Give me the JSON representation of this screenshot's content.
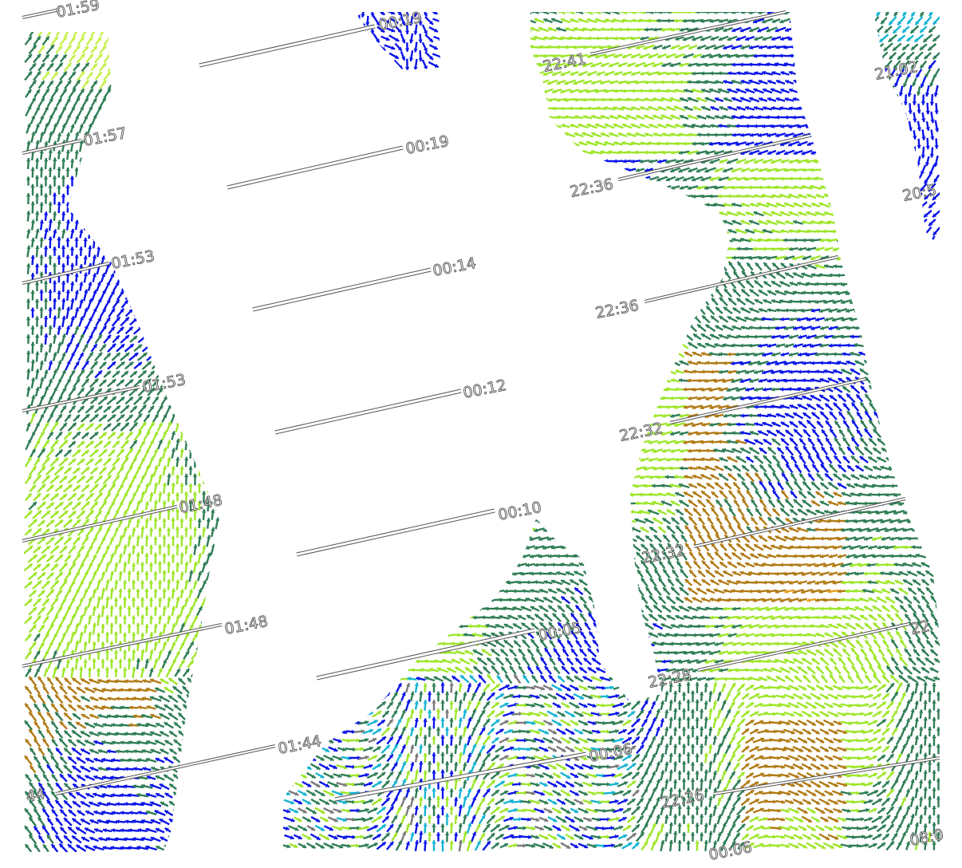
{
  "map": {
    "kind": "scatterometer wind vector swaths",
    "colors": {
      "background": "#ffffff",
      "blue": "#0a14e6",
      "cyan": "#17b4d2",
      "grey": "#7a7a7a",
      "dark_green": "#2e7d55",
      "lime": "#9ee62a",
      "light_green": "#c6f04a",
      "brown": "#b07a14",
      "orange": "#e6a01e",
      "track_fill": "#ffffff",
      "track_outline": "#555555"
    },
    "time_labels": [
      "01:59",
      "00:19",
      "22:41",
      "21:02",
      "01:57",
      "00:19",
      "22:36",
      "20:5",
      "01:53",
      "00:14",
      "22:36",
      "01:53",
      "00:12",
      "22:32",
      "01:48",
      "00:10",
      "22:32",
      "01:48",
      "00:05",
      "22:28",
      "22",
      "01:44",
      "00:06",
      "22:26",
      "44",
      "00:06",
      "08:0"
    ]
  }
}
